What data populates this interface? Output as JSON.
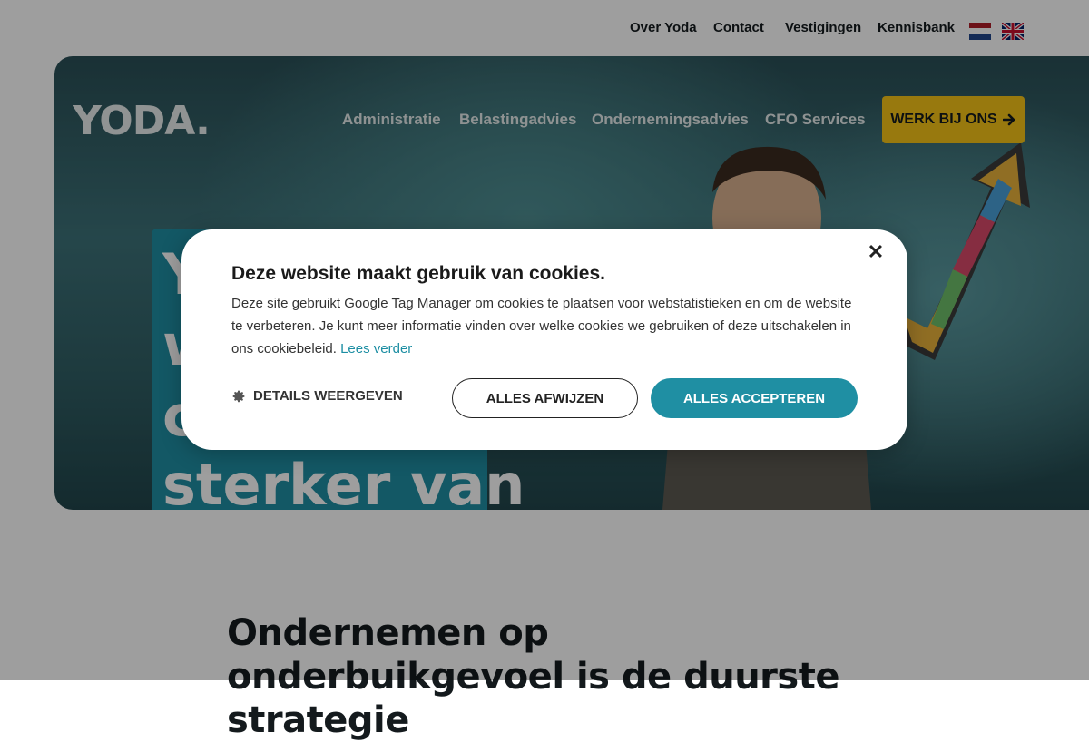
{
  "topnav": {
    "links": [
      "Over Yoda",
      "Contact",
      "Vestigingen",
      "Kennisbank"
    ],
    "languages": [
      "nl-flag",
      "en-flag"
    ]
  },
  "header": {
    "logo_text": "YODA.",
    "nav": [
      "Administratie",
      "Belastingadvies",
      "Ondernemingsadvies",
      "CFO Services"
    ],
    "cta_label": "WERK BIJ ONS",
    "cta_icon": "arrow-right-icon"
  },
  "hero": {
    "headline_lines_visible": [
      "Y",
      "w",
      "c",
      "sterker van"
    ]
  },
  "intro": {
    "title": "Ondernemen op onderbuikgevoel is de duurste strategie"
  },
  "cookie_dialog": {
    "title": "Deze website maakt gebruik van cookies.",
    "body": "Deze site gebruikt Google Tag Manager om cookies te plaatsen voor webstatistieken en om de website te verbeteren. Je kunt meer informatie vinden over welke cookies we gebruiken of deze uitschakelen in ons cookiebeleid.",
    "link_label": "Lees verder",
    "details_label": "DETAILS WEERGEVEN",
    "reject_label": "ALLES AFWIJZEN",
    "accept_label": "ALLES ACCEPTEREN",
    "close_symbol": "✕"
  },
  "colors": {
    "accent_teal": "#1f8fa3",
    "cta_yellow": "#f5c318",
    "text_dark": "#141a1d"
  }
}
